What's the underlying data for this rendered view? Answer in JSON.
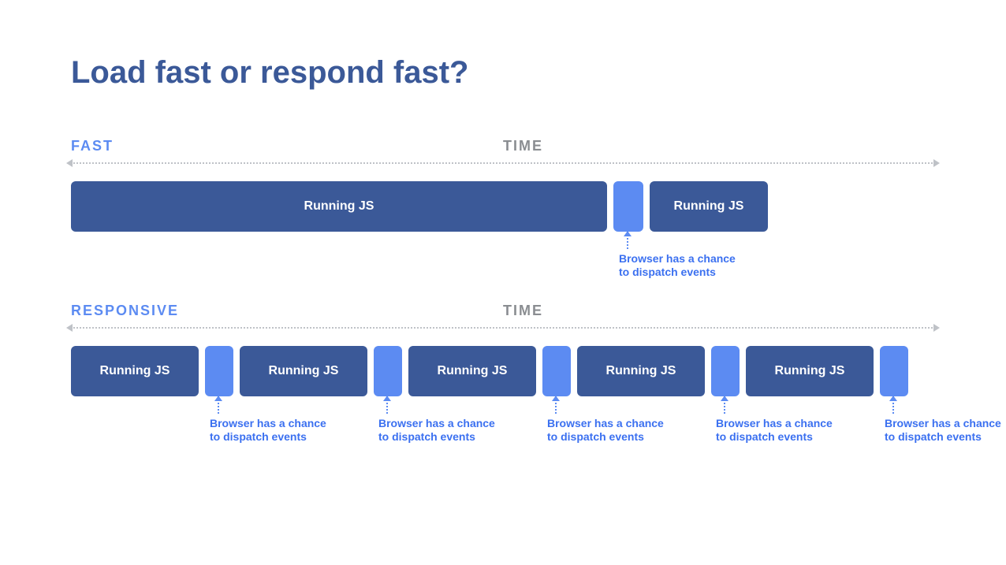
{
  "title": "Load fast or respond fast?",
  "axis_label": "TIME",
  "sections": {
    "fast": {
      "label": "FAST",
      "blocks": [
        "Running JS",
        "Running JS"
      ],
      "gap_annot": "Browser has a chance to dispatch events"
    },
    "responsive": {
      "label": "RESPONSIVE",
      "blocks": [
        "Running JS",
        "Running JS",
        "Running JS",
        "Running JS",
        "Running JS"
      ],
      "gap_annot": "Browser has a chance to dispatch events"
    }
  },
  "colors": {
    "heading": "#3b5998",
    "block": "#3b5998",
    "gap": "#5c8bf2",
    "axis": "#bfc2c7",
    "time_label": "#8a8d91",
    "annot_text": "#3b70f0"
  }
}
